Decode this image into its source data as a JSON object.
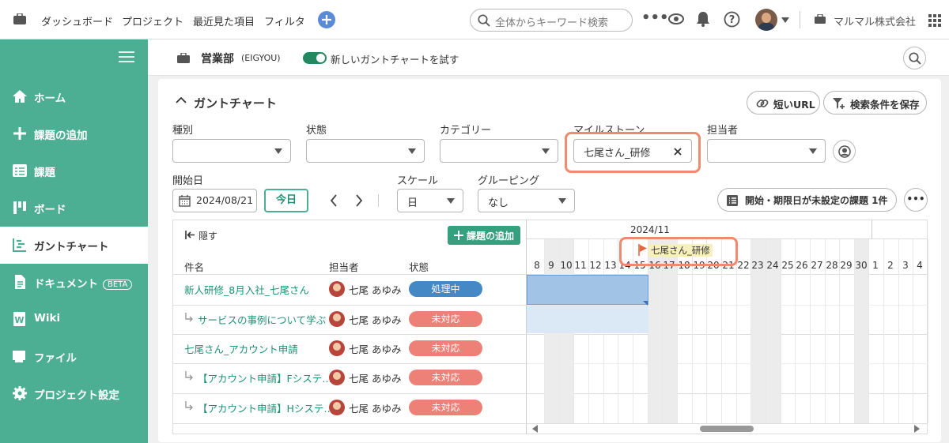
{
  "topbar": {
    "nav": [
      "ダッシュボード",
      "プロジェクト",
      "最近見た項目",
      "フィルタ"
    ],
    "search_placeholder": "全体からキーワード検索",
    "org_name": "マルマル株式会社"
  },
  "sidebar": {
    "items": [
      {
        "label": "ホーム",
        "icon": "home-icon"
      },
      {
        "label": "課題の追加",
        "icon": "plus-icon"
      },
      {
        "label": "課題",
        "icon": "list-icon"
      },
      {
        "label": "ボード",
        "icon": "board-icon"
      },
      {
        "label": "ガントチャート",
        "icon": "gantt-icon",
        "active": true
      },
      {
        "label": "ドキュメント",
        "icon": "document-icon",
        "badge": "BETA"
      },
      {
        "label": "Wiki",
        "icon": "wiki-icon"
      },
      {
        "label": "ファイル",
        "icon": "folder-icon"
      },
      {
        "label": "プロジェクト設定",
        "icon": "gear-icon"
      }
    ]
  },
  "project": {
    "name": "営業部",
    "key": "(EIGYOU)",
    "toggle_label": "新しいガントチャートを試す"
  },
  "gantt": {
    "title": "ガントチャート",
    "short_url": "短いURL",
    "save_search": "検索条件を保存",
    "filters": {
      "type_label": "種別",
      "status_label": "状態",
      "category_label": "カテゴリー",
      "milestone_label": "マイルストーン",
      "milestone_value": "七尾さん_研修",
      "assignee_label": "担当者"
    },
    "start_label": "開始日",
    "start_date": "2024/08/21",
    "today": "今日",
    "scale_label": "スケール",
    "scale_value": "日",
    "grouping_label": "グルーピング",
    "grouping_value": "なし",
    "unscheduled": "開始・期限日が未設定の課題 1件",
    "hide": "隠す",
    "add_issue": "課題の追加",
    "col_name": "件名",
    "col_assignee": "担当者",
    "col_status": "状態",
    "month": "2024/11",
    "milestone_flag": "七尾さん_研修",
    "days": [
      "8",
      "9",
      "10",
      "11",
      "12",
      "13",
      "14",
      "15",
      "16",
      "17",
      "18",
      "19",
      "20",
      "21",
      "22",
      "23",
      "24",
      "25",
      "26",
      "27",
      "28",
      "29",
      "30",
      "1",
      "2",
      "3",
      "4"
    ],
    "rows": [
      {
        "name": "新人研修_8月入社_七尾さん",
        "assignee": "七尾 あゆみ",
        "status": "処理中",
        "status_color": "#4488c5"
      },
      {
        "name": "サービスの事例について学ぶ",
        "assignee": "七尾 あゆみ",
        "status": "未対応",
        "status_color": "#ed8077",
        "child": true
      },
      {
        "name": "七尾さん_アカウント申請",
        "assignee": "七尾 あゆみ",
        "status": "未対応",
        "status_color": "#ed8077"
      },
      {
        "name": "【アカウント申請】Fシステ…",
        "assignee": "七尾 あゆみ",
        "status": "未対応",
        "status_color": "#ed8077",
        "child": true
      },
      {
        "name": "【アカウント申請】Hシステ…",
        "assignee": "七尾 あゆみ",
        "status": "未対応",
        "status_color": "#ed8077",
        "child": true
      }
    ]
  }
}
